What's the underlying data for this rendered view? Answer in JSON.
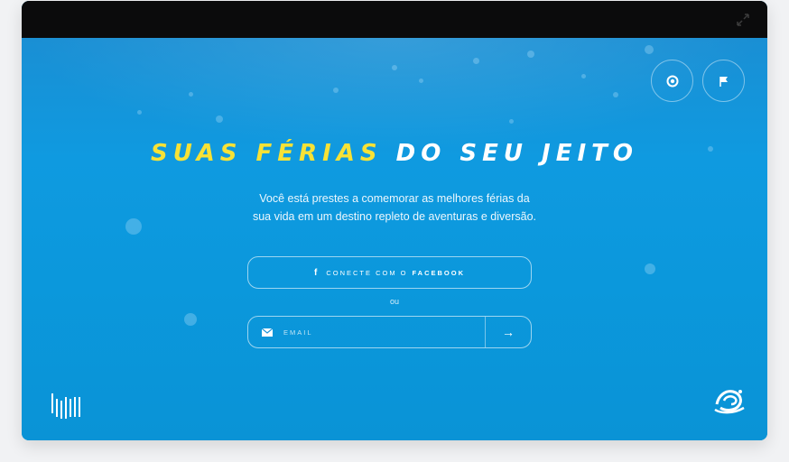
{
  "hero": {
    "headline_highlight": "SUAS FÉRIAS",
    "headline_rest": "DO SEU JEITO",
    "subtitle_line1": "Você está prestes a comemorar as melhores férias da",
    "subtitle_line2": "sua vida em um destino repleto de aventuras e diversão."
  },
  "actions": {
    "facebook_icon": "f",
    "facebook_label": "CONECTE COM O",
    "facebook_brand": "FACEBOOK",
    "or_text": "ou",
    "email_placeholder": "EMAIL",
    "submit_arrow": "→"
  },
  "icons": {
    "help": "lifebuoy-icon",
    "flag": "flag-icon",
    "expand": "expand-icon",
    "email": "envelope-icon",
    "brand_left": "barcode-logo",
    "brand_right": "wave-logo"
  },
  "colors": {
    "accent_yellow": "#f7e236",
    "ocean_blue": "#0e97d9",
    "titlebar": "#0b0b0c"
  }
}
